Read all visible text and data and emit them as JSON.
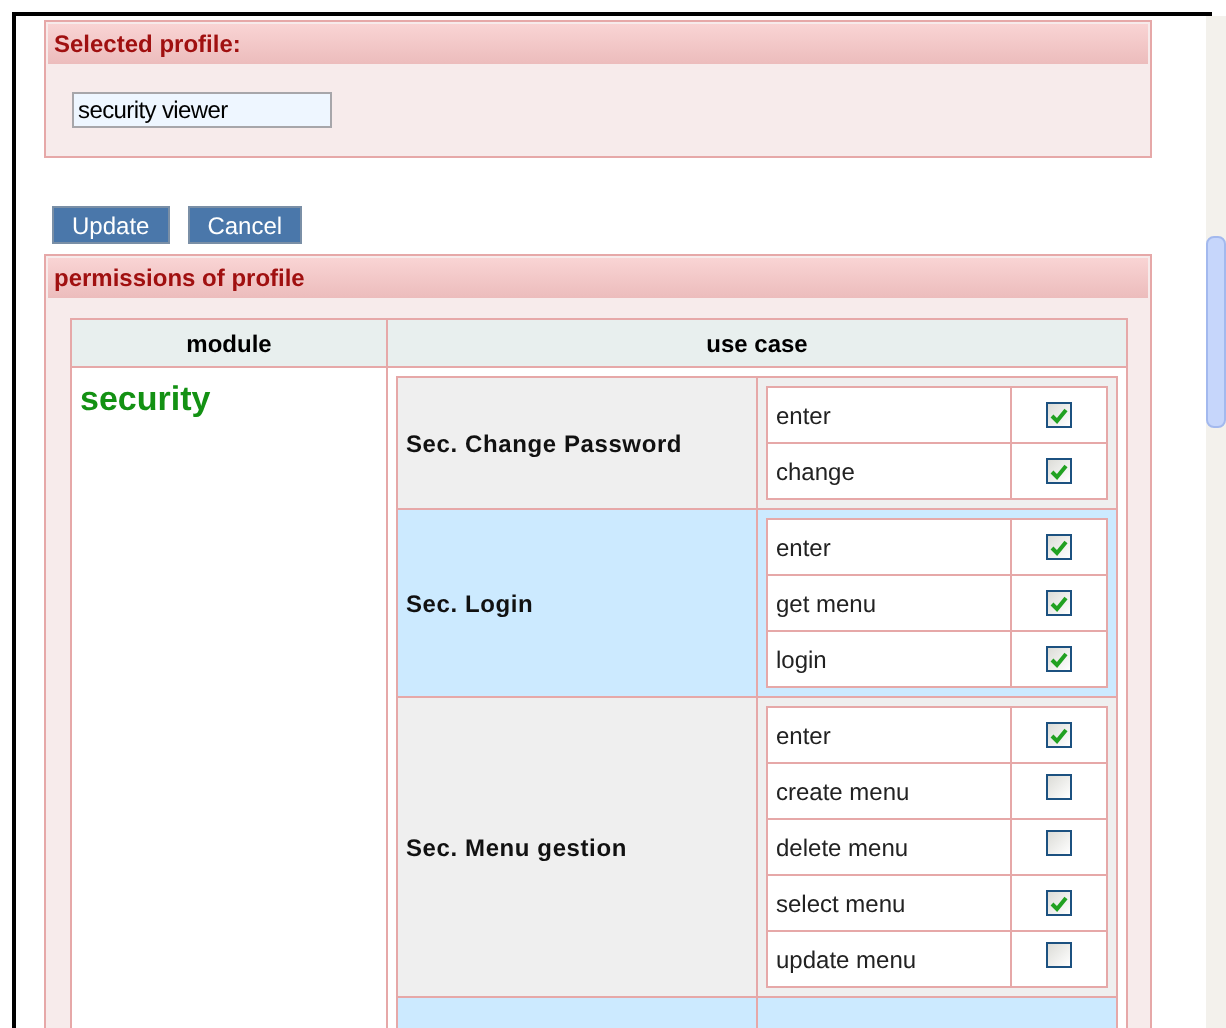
{
  "selected_profile": {
    "title": "Selected profile:",
    "value": "security viewer"
  },
  "buttons": [
    "Update",
    "Cancel"
  ],
  "permissions": {
    "title": "permissions of profile",
    "columns": [
      "module",
      "use case"
    ],
    "module": "security",
    "use_cases": [
      {
        "name": "Sec. Change Password",
        "permissions": [
          {
            "label": "enter",
            "checked": true
          },
          {
            "label": "change",
            "checked": true
          }
        ]
      },
      {
        "name": "Sec. Login",
        "permissions": [
          {
            "label": "enter",
            "checked": true
          },
          {
            "label": "get menu",
            "checked": true
          },
          {
            "label": "login",
            "checked": true
          }
        ]
      },
      {
        "name": "Sec. Menu gestion",
        "permissions": [
          {
            "label": "enter",
            "checked": true
          },
          {
            "label": "create menu",
            "checked": false
          },
          {
            "label": "delete menu",
            "checked": false
          },
          {
            "label": "select menu",
            "checked": true
          },
          {
            "label": "update menu",
            "checked": false
          }
        ]
      }
    ]
  }
}
